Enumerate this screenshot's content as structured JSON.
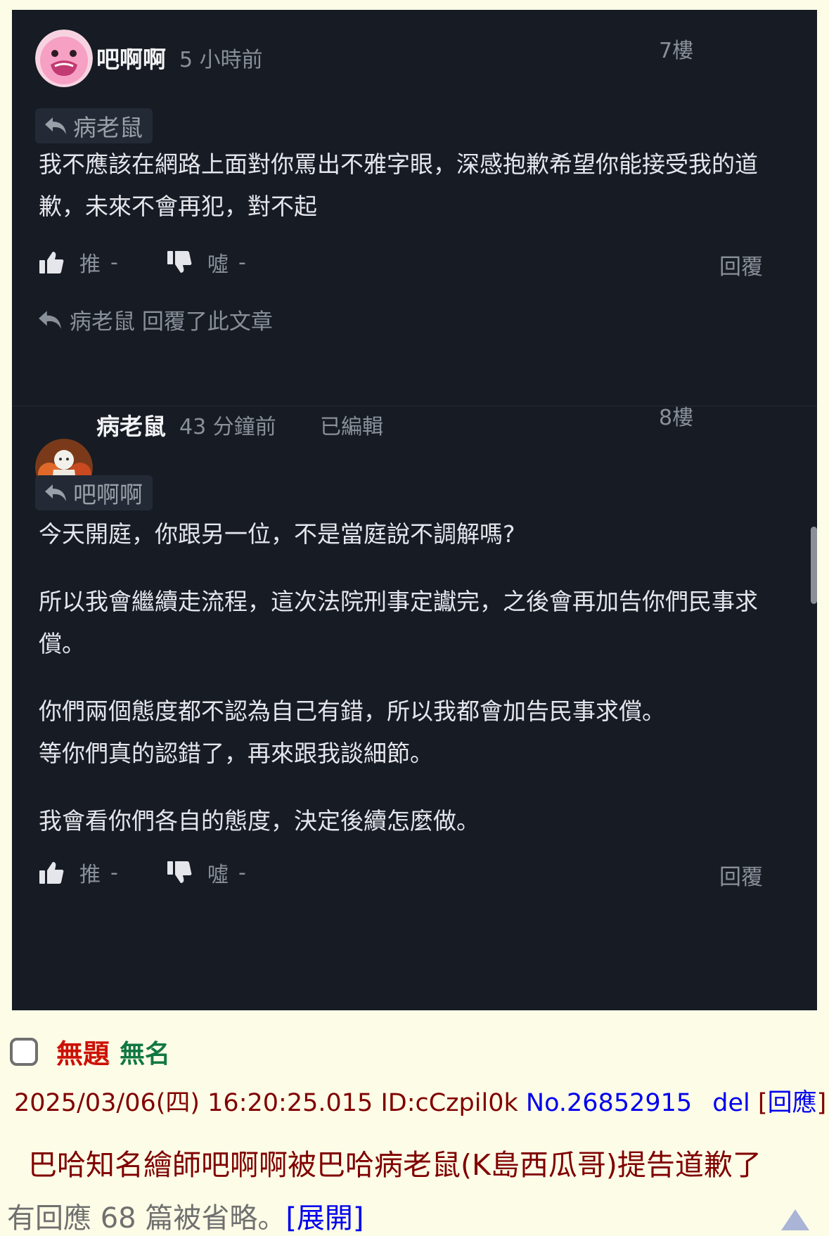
{
  "thread": {
    "comments": [
      {
        "author": "吧啊啊",
        "time": "5 小時前",
        "edited": "",
        "floor": "7樓",
        "quote_to": "病老鼠",
        "paragraphs": [
          "我不應該在網路上面對你罵出不雅字眼，深感抱歉希望你能接受我的道歉，未來不會再犯，對不起"
        ],
        "like_label": "推",
        "like_count": "-",
        "dislike_label": "噓",
        "dislike_count": "-",
        "reply_label": "回覆",
        "replied_note": "病老鼠 回覆了此文章"
      },
      {
        "author": "病老鼠",
        "time": "43 分鐘前",
        "edited": "已編輯",
        "floor": "8樓",
        "quote_to": "吧啊啊",
        "paragraphs": [
          "今天開庭，你跟另一位，不是當庭說不調解嗎?",
          "所以我會繼續走流程，這次法院刑事定讞完，之後會再加告你們民事求償。",
          "你們兩個態度都不認為自己有錯，所以我都會加告民事求償。",
          "等你們真的認錯了，再來跟我談細節。",
          "我會看你們各自的態度，決定後續怎麼做。"
        ],
        "like_label": "推",
        "like_count": "-",
        "dislike_label": "噓",
        "dislike_count": "-",
        "reply_label": "回覆"
      }
    ]
  },
  "post": {
    "title": "無題",
    "name": "無名",
    "datetime": "2025/03/06(四) 16:20:25.015",
    "id": "ID:cCzpil0k",
    "number": "No.26852915",
    "del_label": "del",
    "reply_link_open": "[",
    "reply_link_label": "回應",
    "reply_link_close": "]",
    "subject": "巴哈知名繪師吧啊啊被巴哈病老鼠(K島西瓜哥)提告道歉了",
    "omitted_text": "有回應 68 篇被省略。",
    "expand_label": "[展開]"
  },
  "icons": {
    "reply_arrow": "reply-arrow-icon",
    "thumb_up": "thumbs-up-icon",
    "thumb_down": "thumbs-down-icon",
    "scroll_top": "scroll-top-arrow-icon"
  },
  "colors": {
    "dark_bg": "#161b24",
    "board_bg": "#fdfde7",
    "title_red": "#cc1105",
    "name_green": "#117743",
    "meta_maroon": "#800000",
    "link_blue": "#0000ee"
  }
}
